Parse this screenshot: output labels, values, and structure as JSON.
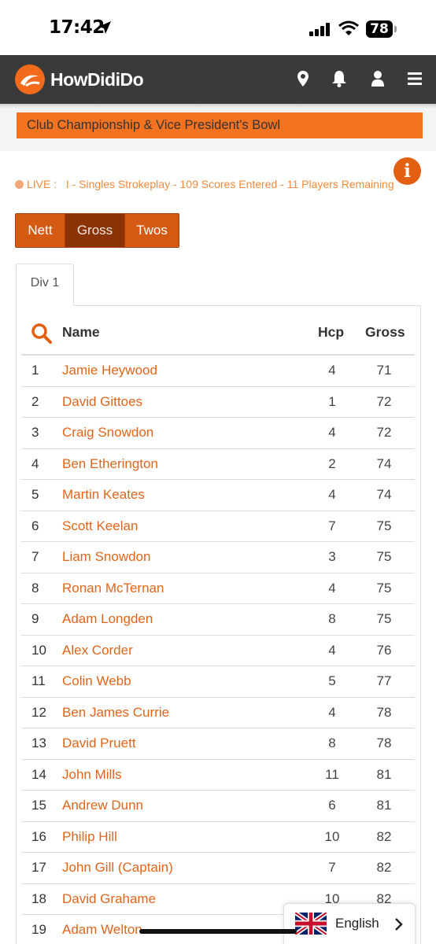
{
  "status_bar": {
    "time": "17:42",
    "battery": "78"
  },
  "navbar": {
    "logo_text": "HowDidiDo"
  },
  "banner": {
    "title": "Club Championship & Vice President's Bowl"
  },
  "live": {
    "text": "LIVE :   I - Singles Strokeplay - 109 Scores Entered - 11 Players Remaining"
  },
  "score_type_buttons": [
    {
      "label": "Nett",
      "active": false
    },
    {
      "label": "Gross",
      "active": true
    },
    {
      "label": "Twos",
      "active": false
    }
  ],
  "division_tab": {
    "label": "Div 1"
  },
  "table": {
    "headers": {
      "name": "Name",
      "hcp": "Hcp",
      "gross": "Gross"
    },
    "rows": [
      {
        "pos": "1",
        "name": "Jamie Heywood",
        "hcp": "4",
        "gross": "71"
      },
      {
        "pos": "2",
        "name": "David Gittoes",
        "hcp": "1",
        "gross": "72"
      },
      {
        "pos": "3",
        "name": "Craig Snowdon",
        "hcp": "4",
        "gross": "72"
      },
      {
        "pos": "4",
        "name": "Ben Etherington",
        "hcp": "2",
        "gross": "74"
      },
      {
        "pos": "5",
        "name": "Martin Keates",
        "hcp": "4",
        "gross": "74"
      },
      {
        "pos": "6",
        "name": "Scott Keelan",
        "hcp": "7",
        "gross": "75"
      },
      {
        "pos": "7",
        "name": "Liam Snowdon",
        "hcp": "3",
        "gross": "75"
      },
      {
        "pos": "8",
        "name": "Ronan McTernan",
        "hcp": "4",
        "gross": "75"
      },
      {
        "pos": "9",
        "name": "Adam Longden",
        "hcp": "8",
        "gross": "75"
      },
      {
        "pos": "10",
        "name": "Alex Corder",
        "hcp": "4",
        "gross": "76"
      },
      {
        "pos": "11",
        "name": "Colin Webb",
        "hcp": "5",
        "gross": "77"
      },
      {
        "pos": "12",
        "name": "Ben James Currie",
        "hcp": "4",
        "gross": "78"
      },
      {
        "pos": "13",
        "name": "David Pruett",
        "hcp": "8",
        "gross": "78"
      },
      {
        "pos": "14",
        "name": "John Mills",
        "hcp": "11",
        "gross": "81"
      },
      {
        "pos": "15",
        "name": "Andrew Dunn",
        "hcp": "6",
        "gross": "81"
      },
      {
        "pos": "16",
        "name": "Philip Hill",
        "hcp": "10",
        "gross": "82"
      },
      {
        "pos": "17",
        "name": "John Gill (Captain)",
        "hcp": "7",
        "gross": "82"
      },
      {
        "pos": "18",
        "name": "David Grahame",
        "hcp": "10",
        "gross": "82"
      },
      {
        "pos": "19",
        "name": "Adam Welton",
        "hcp": "",
        "gross": ""
      }
    ]
  },
  "language": {
    "label": "English"
  },
  "colors": {
    "accent": "#f47321",
    "navbar": "#3a3a3a",
    "link": "#e0651a",
    "active_button": "#8c3207"
  }
}
